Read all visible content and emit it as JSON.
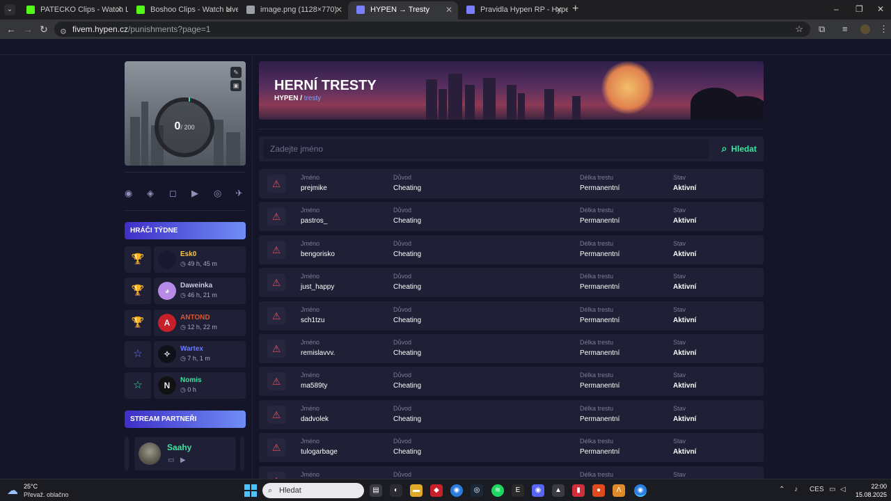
{
  "browser": {
    "tabs": [
      {
        "title": "PATECKO Clips - Watch Live on",
        "color": "#53fc18"
      },
      {
        "title": "Boshoo Clips - Watch Live on K",
        "color": "#53fc18"
      },
      {
        "title": "image.png (1128×770)",
        "color": "#9aa0a6"
      },
      {
        "title": "HYPEN → Tresty",
        "color": "#7b7fff"
      },
      {
        "title": "Pravidla Hypen RP - Hypen",
        "color": "#7b7fff"
      }
    ],
    "url_host": "fivem.hypen.cz",
    "url_path": "/punishments?page=1"
  },
  "sidebar": {
    "stats": {
      "current": "0",
      "max": "/ 200"
    },
    "players_header": "HRÁČI TÝDNE",
    "players": [
      {
        "name": "Esk0",
        "time": "49 h, 45 m",
        "name_color": "#f3c84b",
        "rank_icon": "trophy-gold-icon",
        "rank_glyph": "🏆",
        "rank_color": "#f3c84b",
        "avatar_text": "",
        "avatar_bg": "#1a1830"
      },
      {
        "name": "Daweinka",
        "time": "46 h, 21 m",
        "name_color": "#c9cbe0",
        "rank_icon": "trophy-silver-icon",
        "rank_glyph": "🏆",
        "rank_color": "#c9cbe0",
        "avatar_text": "◕",
        "avatar_bg": "#b88ae8"
      },
      {
        "name": "ANTOND",
        "time": "12 h, 22 m",
        "name_color": "#d8572f",
        "rank_icon": "trophy-bronze-icon",
        "rank_glyph": "🏆",
        "rank_color": "#d8572f",
        "avatar_text": "A",
        "avatar_bg": "#c8202a"
      },
      {
        "name": "Wartex",
        "time": "7 h, 1 m",
        "name_color": "#6a7cff",
        "rank_icon": "star-blue-icon",
        "rank_glyph": "☆",
        "rank_color": "#6a7cff",
        "avatar_text": "✧",
        "avatar_bg": "#101018"
      },
      {
        "name": "Nomis",
        "time": "0 h",
        "name_color": "#3fe3a0",
        "rank_icon": "star-green-icon",
        "rank_glyph": "☆",
        "rank_color": "#3fe3a0",
        "avatar_text": "N",
        "avatar_bg": "#121212"
      }
    ],
    "partners_header": "STREAM PARTNEŘI",
    "partner": {
      "name": "Saahy"
    }
  },
  "banner": {
    "title": "HERNÍ TRESTY",
    "crumb_home": "HYPEN /",
    "crumb_current": "tresty"
  },
  "search": {
    "placeholder": "Zadejte jméno",
    "button": "Hledat"
  },
  "labels": {
    "name": "Jméno",
    "reason": "Důvod",
    "length": "Délka trestu",
    "status": "Stav"
  },
  "punishments": [
    {
      "name": "prejmike",
      "reason": "Cheating",
      "length": "Permanentní",
      "status": "Aktivní"
    },
    {
      "name": "pastros_",
      "reason": "Cheating",
      "length": "Permanentní",
      "status": "Aktivní"
    },
    {
      "name": "bengorisko",
      "reason": "Cheating",
      "length": "Permanentní",
      "status": "Aktivní"
    },
    {
      "name": "just_happy",
      "reason": "Cheating",
      "length": "Permanentní",
      "status": "Aktivní"
    },
    {
      "name": "sch1tzu",
      "reason": "Cheating",
      "length": "Permanentní",
      "status": "Aktivní"
    },
    {
      "name": "remislavvv.",
      "reason": "Cheating",
      "length": "Permanentní",
      "status": "Aktivní"
    },
    {
      "name": "ma589ty",
      "reason": "Cheating",
      "length": "Permanentní",
      "status": "Aktivní"
    },
    {
      "name": "dadvolek",
      "reason": "Cheating",
      "length": "Permanentní",
      "status": "Aktivní"
    },
    {
      "name": "tulogarbage",
      "reason": "Cheating",
      "length": "Permanentní",
      "status": "Aktivní"
    },
    {
      "name": "",
      "reason": "",
      "length": "",
      "status": ""
    }
  ],
  "taskbar": {
    "temp": "25°C",
    "weather": "Převaž. oblačno",
    "search": "Hledat",
    "lang": "CES",
    "time": "22:00",
    "date": "15.08.2025"
  }
}
